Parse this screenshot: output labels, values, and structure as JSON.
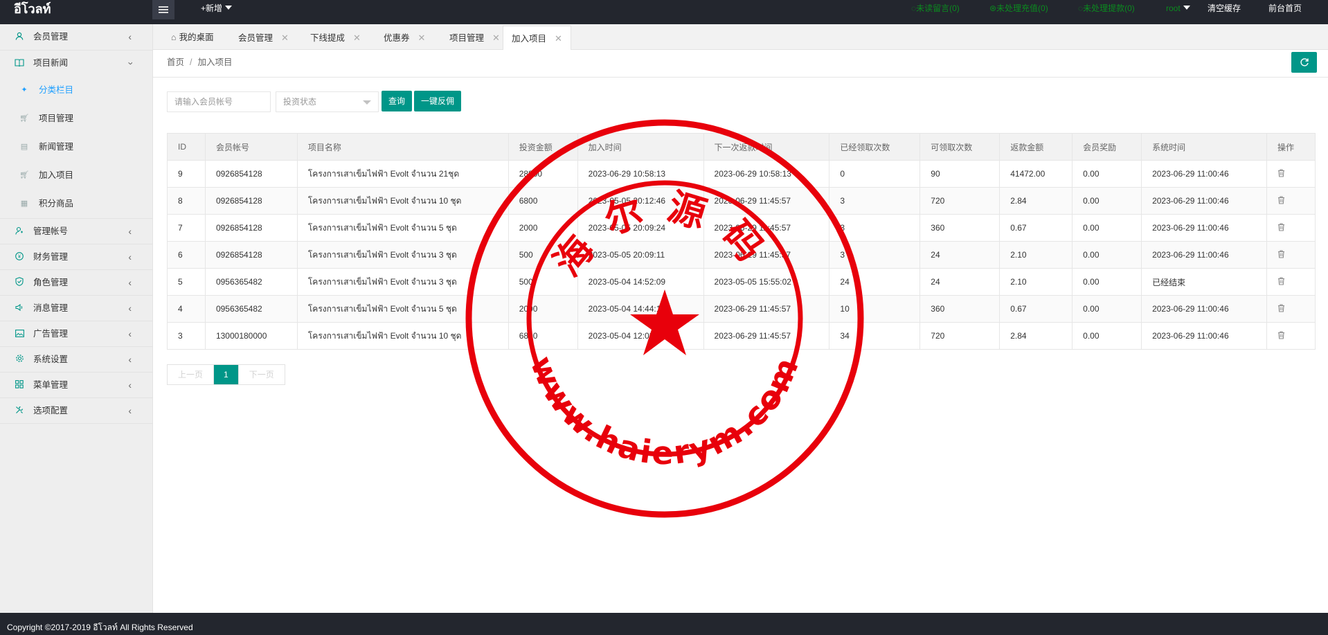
{
  "header": {
    "logo": "อีโวลท์",
    "add_new": "+新增",
    "unread_msg": "◌未读留言(0)",
    "unprocessed_recharge": "⊛未处理充值(0)",
    "unprocessed_withdraw": "◌未处理提款(0)",
    "user": "root",
    "clear_cache": "清空缓存",
    "front_home": "前台首页",
    "colors": {
      "bar": "#23262e",
      "green": "#0b8a1f"
    }
  },
  "sidebar": {
    "items": [
      {
        "label": "会员管理",
        "icon": "user-icon"
      },
      {
        "label": "项目新闻",
        "icon": "book-icon"
      },
      {
        "label": "管理帐号",
        "icon": "admin-icon"
      },
      {
        "label": "财务管理",
        "icon": "yen-icon"
      },
      {
        "label": "角色管理",
        "icon": "shield-icon"
      },
      {
        "label": "消息管理",
        "icon": "speaker-icon"
      },
      {
        "label": "广告管理",
        "icon": "image-icon"
      },
      {
        "label": "系统设置",
        "icon": "gear-icon"
      },
      {
        "label": "菜单管理",
        "icon": "grid-icon"
      },
      {
        "label": "选项配置",
        "icon": "tools-icon"
      }
    ],
    "sub_items": [
      {
        "label": "分类栏目",
        "icon": "tag-icon"
      },
      {
        "label": "项目管理",
        "icon": "cart-icon"
      },
      {
        "label": "新闻管理",
        "icon": "file-icon"
      },
      {
        "label": "加入项目",
        "icon": "cart-icon"
      },
      {
        "label": "积分商品",
        "icon": "points-icon"
      }
    ]
  },
  "tabs": [
    {
      "label": "我的桌面"
    },
    {
      "label": "会员管理"
    },
    {
      "label": "下线提成"
    },
    {
      "label": "优惠券"
    },
    {
      "label": "项目管理"
    },
    {
      "label": "加入项目"
    }
  ],
  "breadcrumb": {
    "home": "首页",
    "sep": "/",
    "current": "加入项目"
  },
  "search": {
    "account_placeholder": "请输入会员帐号",
    "status_placeholder": "投资状态",
    "query_button": "查询",
    "rebate_button": "一键反佣"
  },
  "table": {
    "columns": [
      "ID",
      "会员帐号",
      "项目名称",
      "投资金额",
      "加入时间",
      "下一次返款时间",
      "已经领取次数",
      "可领取次数",
      "返款金额",
      "会员奖励",
      "系统时间",
      "操作"
    ],
    "rows": [
      [
        "9",
        "0926854128",
        "โครงการเสาเข็มไฟฟ้า Evolt จำนวน 21ชุด",
        "28800",
        "2023-06-29 10:58:13",
        "2023-06-29 10:58:13",
        "0",
        "90",
        "41472.00",
        "0.00",
        "2023-06-29 11:00:46"
      ],
      [
        "8",
        "0926854128",
        "โครงการเสาเข็มไฟฟ้า Evolt จำนวน 10 ชุด",
        "6800",
        "2023-05-05 20:12:46",
        "2023-06-29 11:45:57",
        "3",
        "720",
        "2.84",
        "0.00",
        "2023-06-29 11:00:46"
      ],
      [
        "7",
        "0926854128",
        "โครงการเสาเข็มไฟฟ้า Evolt จำนวน 5 ชุด",
        "2000",
        "2023-05-05 20:09:24",
        "2023-06-29 11:45:57",
        "3",
        "360",
        "0.67",
        "0.00",
        "2023-06-29 11:00:46"
      ],
      [
        "6",
        "0926854128",
        "โครงการเสาเข็มไฟฟ้า Evolt จำนวน 3 ชุด",
        "500",
        "2023-05-05 20:09:11",
        "2023-06-29 11:45:57",
        "3",
        "24",
        "2.10",
        "0.00",
        "2023-06-29 11:00:46"
      ],
      [
        "5",
        "0956365482",
        "โครงการเสาเข็มไฟฟ้า Evolt จำนวน 3 ชุด",
        "500",
        "2023-05-04 14:52:09",
        "2023-05-05 15:55:02",
        "24",
        "24",
        "2.10",
        "0.00",
        "已经结束"
      ],
      [
        "4",
        "0956365482",
        "โครงการเสาเข็มไฟฟ้า Evolt จำนวน 5 ชุด",
        "2000",
        "2023-05-04 14:44:18",
        "2023-06-29 11:45:57",
        "10",
        "360",
        "0.67",
        "0.00",
        "2023-06-29 11:00:46"
      ],
      [
        "3",
        "13000180000",
        "โครงการเสาเข็มไฟฟ้า Evolt จำนวน 10 ชุด",
        "6800",
        "2023-05-04 12:03:26",
        "2023-06-29 11:45:57",
        "34",
        "720",
        "2.84",
        "0.00",
        "2023-06-29 11:00:46"
      ]
    ],
    "action_icon": "trash-icon"
  },
  "pager": {
    "prev": "上一页",
    "current": "1",
    "next": "下一页"
  },
  "footer": {
    "copyright": "Copyright ©2017-2019 อีโวลท์ All Rights Reserved"
  },
  "watermark": {
    "top_text": "海尔源码",
    "bottom_text": "www.haierym.com",
    "color": "#e8000b"
  },
  "theme": {
    "accent": "#009688",
    "active_link": "#1e9fff"
  }
}
